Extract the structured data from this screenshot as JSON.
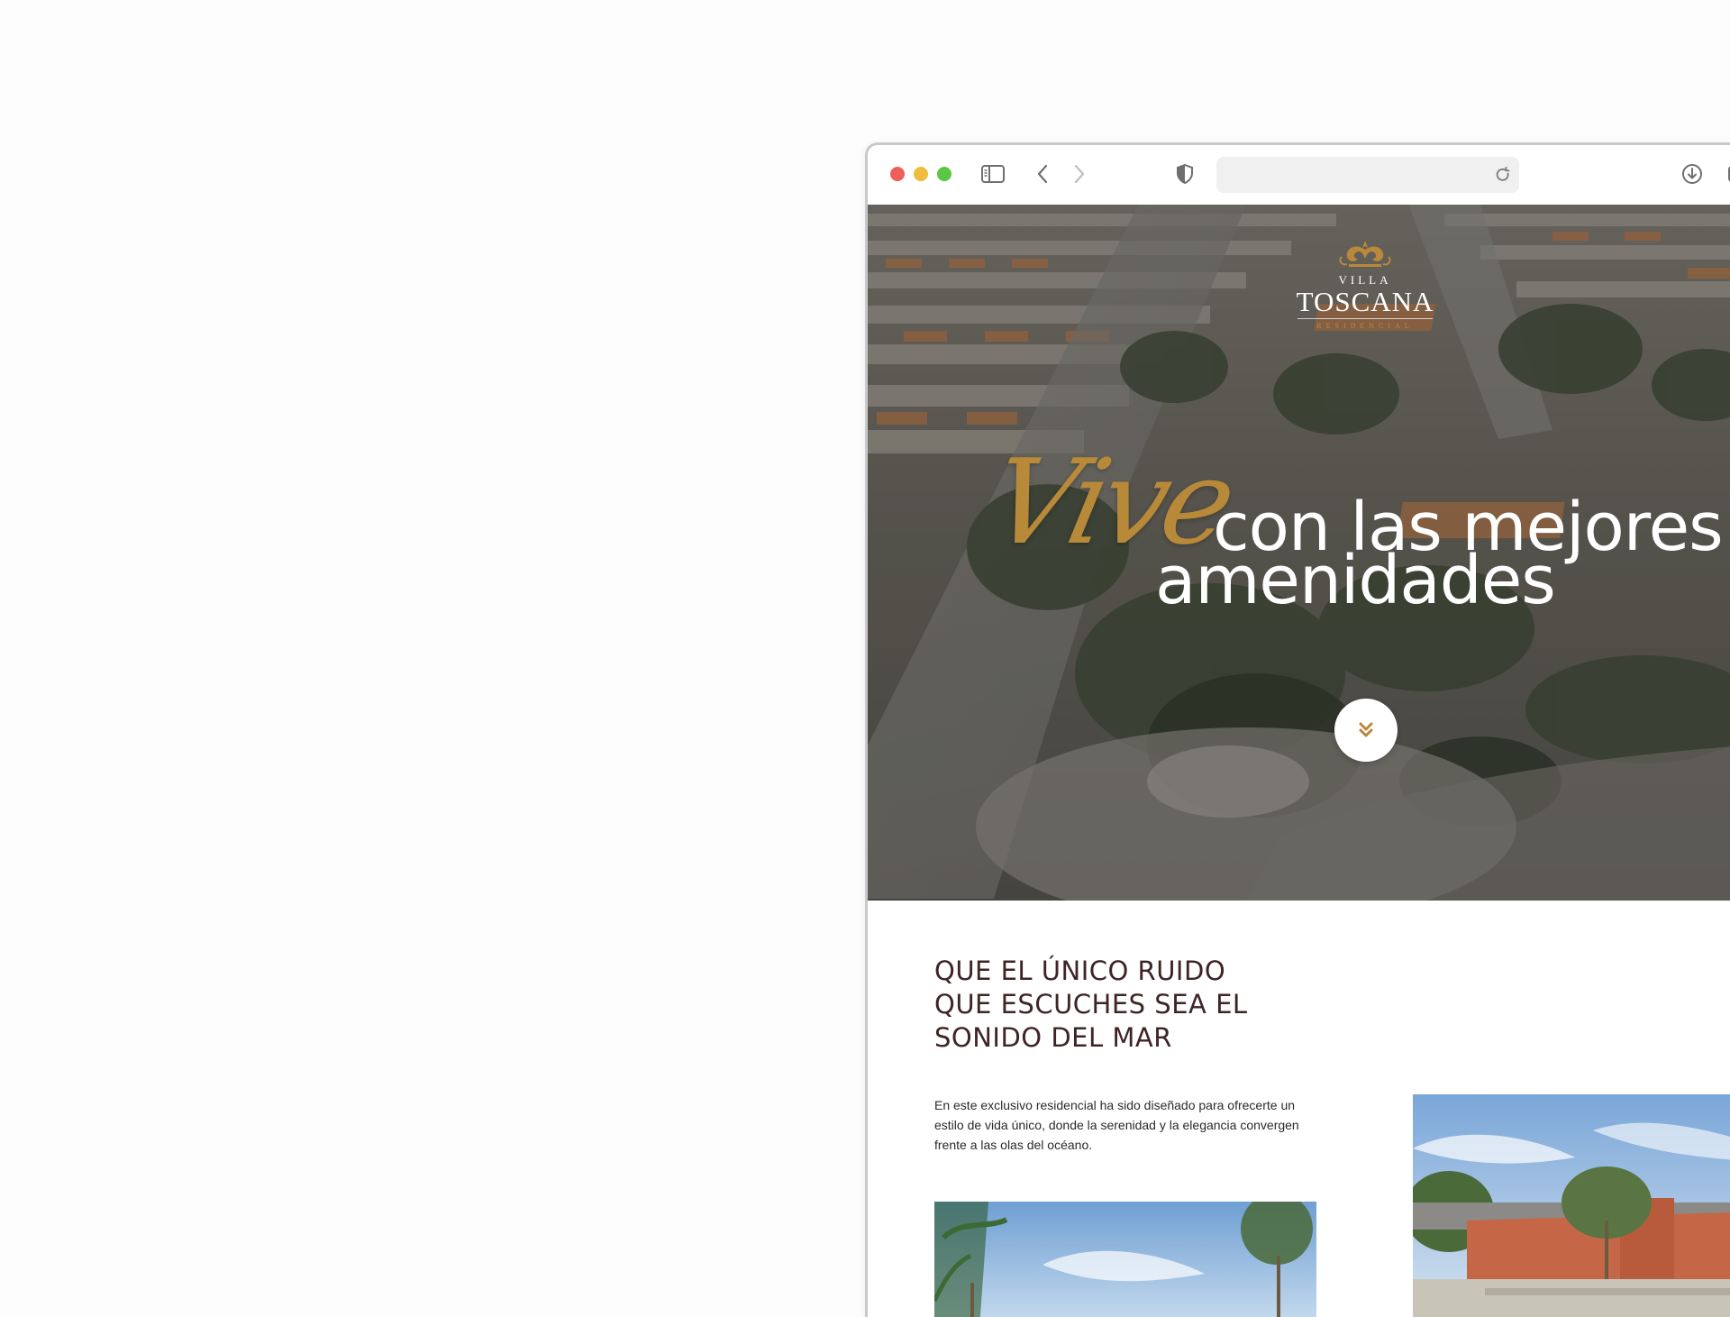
{
  "browser": {
    "toolbar_icons": [
      "close-dot",
      "minimize-dot",
      "zoom-dot",
      "sidebar-icon",
      "back-icon",
      "forward-icon",
      "shield-icon",
      "reload-icon",
      "download-icon",
      "tabs-icon"
    ],
    "address_value": ""
  },
  "hero": {
    "logo": {
      "top": "VILLA",
      "name": "TOSCANA",
      "sub": "RESIDENCIAL"
    },
    "script_word": "Vive",
    "headline_line1": "con las mejores",
    "headline_line2": "amenidades",
    "scroll_icon": "double-chevron-down-icon"
  },
  "section": {
    "title_lines": [
      "QUE EL ÚNICO RUIDO",
      "QUE ESCUCHES SEA EL",
      "SONIDO DEL MAR"
    ],
    "body": "En este exclusivo residencial ha sido diseñado para ofrecerte un estilo de vida único, donde la serenidad y la elegancia convergen frente a las olas del océano."
  },
  "colors": {
    "accent_gold": "#b9893a",
    "title_brown": "#3f2426",
    "traffic_red": "#ed5f57",
    "traffic_yellow": "#efbd3c",
    "traffic_green": "#5bc545"
  }
}
